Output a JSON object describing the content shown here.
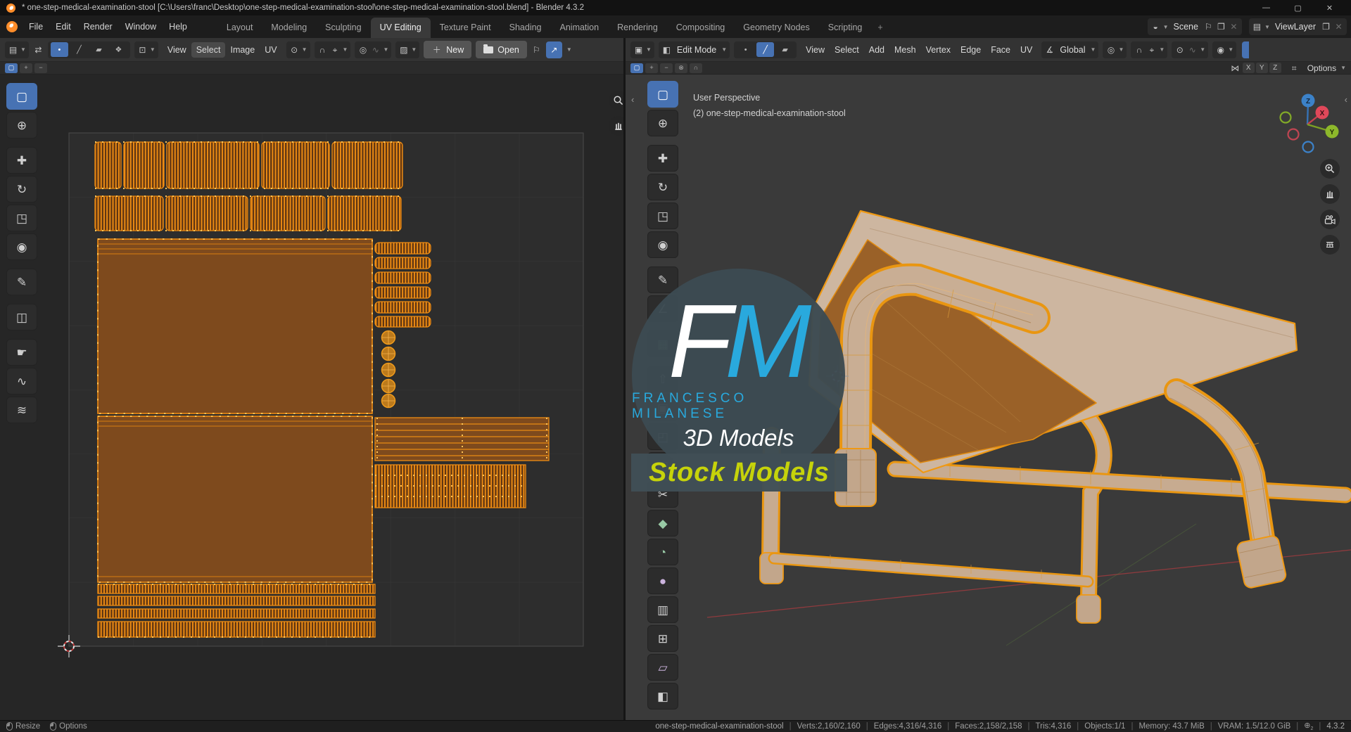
{
  "colors": {
    "blender_orange": "#e87d0d",
    "selection_blue": "#4772b3",
    "uv_edge_orange": "#ee8c13",
    "watermark_accent": "#29a9dd",
    "banner_text": "#c6d30a",
    "axis_x_red": "#e0485a",
    "axis_y_green": "#8db82b",
    "axis_z_blue": "#3c82c9"
  },
  "window": {
    "title": "* one-step-medical-examination-stool [C:\\Users\\franc\\Desktop\\one-step-medical-examination-stool\\one-step-medical-examination-stool.blend] - Blender 4.3.2",
    "minimize": "—",
    "maximize": "▢",
    "close": "✕"
  },
  "topbar": {
    "menus": [
      {
        "label": "File",
        "name": "menu-file"
      },
      {
        "label": "Edit",
        "name": "menu-edit"
      },
      {
        "label": "Render",
        "name": "menu-render"
      },
      {
        "label": "Window",
        "name": "menu-window"
      },
      {
        "label": "Help",
        "name": "menu-help"
      }
    ],
    "tabs": [
      {
        "label": "Layout",
        "name": "tab-layout"
      },
      {
        "label": "Modeling",
        "name": "tab-modeling"
      },
      {
        "label": "Sculpting",
        "name": "tab-sculpting"
      },
      {
        "label": "UV Editing",
        "name": "tab-uv-editing",
        "cls": "active"
      },
      {
        "label": "Texture Paint",
        "name": "tab-texture-paint"
      },
      {
        "label": "Shading",
        "name": "tab-shading"
      },
      {
        "label": "Animation",
        "name": "tab-animation"
      },
      {
        "label": "Rendering",
        "name": "tab-rendering"
      },
      {
        "label": "Compositing",
        "name": "tab-compositing"
      },
      {
        "label": "Geometry Nodes",
        "name": "tab-geometry-nodes"
      },
      {
        "label": "Scripting",
        "name": "tab-scripting"
      },
      {
        "label": "+",
        "name": "tab-add-workspace",
        "cls": "addtab"
      }
    ],
    "scene": {
      "label": "Scene"
    },
    "view_layer": {
      "label": "ViewLayer"
    }
  },
  "uv": {
    "menus": [
      {
        "label": "View",
        "name": "uv-menu-view"
      },
      {
        "label": "Select",
        "name": "uv-menu-select",
        "cls": "hovered"
      },
      {
        "label": "Image",
        "name": "uv-menu-image"
      },
      {
        "label": "UV",
        "name": "uv-menu-uv"
      }
    ],
    "select_modes": [
      {
        "glyph": "•",
        "name": "uv-select-mode-vertex",
        "cls": "active"
      },
      {
        "glyph": "╱",
        "name": "uv-select-mode-edge"
      },
      {
        "glyph": "▰",
        "name": "uv-select-mode-face"
      },
      {
        "glyph": "❖",
        "name": "uv-select-mode-island"
      }
    ],
    "toolrow_modes": [
      {
        "glyph": "▢",
        "name": "uv-tool-mode-set",
        "cls": "active"
      },
      {
        "glyph": "+",
        "name": "uv-tool-mode-extend"
      },
      {
        "glyph": "−",
        "name": "uv-tool-mode-subtract"
      }
    ],
    "new_label": "New",
    "open_label": "Open",
    "toolbar": [
      {
        "glyph": "▢",
        "name": "uv-tool-select-box",
        "cls": "active"
      },
      {
        "glyph": "⊕",
        "name": "uv-tool-2d-cursor"
      },
      {
        "glyph": "✚",
        "name": "uv-tool-move",
        "cls": "gap"
      },
      {
        "glyph": "↻",
        "name": "uv-tool-rotate"
      },
      {
        "glyph": "◳",
        "name": "uv-tool-scale"
      },
      {
        "glyph": "◉",
        "name": "uv-tool-transform"
      },
      {
        "glyph": "✎",
        "name": "uv-tool-annotate",
        "cls": "gap"
      },
      {
        "glyph": "◫",
        "name": "uv-tool-rip-region",
        "cls": "gap"
      },
      {
        "glyph": "☛",
        "name": "uv-tool-grab",
        "cls": "gap"
      },
      {
        "glyph": "∿",
        "name": "uv-tool-relax"
      },
      {
        "glyph": "≋",
        "name": "uv-tool-pinch"
      }
    ]
  },
  "vp": {
    "mode": "Edit Mode",
    "menus": [
      {
        "label": "View",
        "name": "vp-menu-view"
      },
      {
        "label": "Select",
        "name": "vp-menu-select"
      },
      {
        "label": "Add",
        "name": "vp-menu-add"
      },
      {
        "label": "Mesh",
        "name": "vp-menu-mesh"
      },
      {
        "label": "Vertex",
        "name": "vp-menu-vertex"
      },
      {
        "label": "Edge",
        "name": "vp-menu-edge"
      },
      {
        "label": "Face",
        "name": "vp-menu-face"
      },
      {
        "label": "UV",
        "name": "vp-menu-uv"
      }
    ],
    "select_modes": [
      {
        "glyph": "•",
        "name": "vp-select-mode-vertex"
      },
      {
        "glyph": "╱",
        "name": "vp-select-mode-edge",
        "cls": "active"
      },
      {
        "glyph": "▰",
        "name": "vp-select-mode-face"
      }
    ],
    "toolrow_modes": [
      {
        "glyph": "▢",
        "name": "vp-tool-mode-set",
        "cls": "active"
      },
      {
        "glyph": "+",
        "name": "vp-tool-mode-extend"
      },
      {
        "glyph": "−",
        "name": "vp-tool-mode-subtract"
      },
      {
        "glyph": "⊗",
        "name": "vp-tool-mode-invert"
      },
      {
        "glyph": "∩",
        "name": "vp-tool-mode-intersect"
      }
    ],
    "mirror_axes": [
      {
        "label": "X",
        "name": "mirror-x-toggle"
      },
      {
        "label": "Y",
        "name": "mirror-y-toggle"
      },
      {
        "label": "Z",
        "name": "mirror-z-toggle"
      }
    ],
    "orientation": "Global",
    "options_label": "Options",
    "overlay_perspective": "User Perspective",
    "overlay_object": "(2) one-step-medical-examination-stool",
    "gizmo": {
      "x": "X",
      "y": "Y",
      "z": "Z"
    },
    "toolbar": [
      {
        "glyph": "▢",
        "name": "vp-tool-select-box",
        "cls": "active"
      },
      {
        "glyph": "⊕",
        "name": "vp-tool-3d-cursor"
      },
      {
        "glyph": "✚",
        "name": "vp-tool-move",
        "cls": "gap"
      },
      {
        "glyph": "↻",
        "name": "vp-tool-rotate"
      },
      {
        "glyph": "◳",
        "name": "vp-tool-scale"
      },
      {
        "glyph": "◉",
        "name": "vp-tool-transform"
      },
      {
        "glyph": "✎",
        "name": "vp-tool-annotate",
        "cls": "gap"
      },
      {
        "glyph": "∠",
        "name": "vp-tool-measure"
      },
      {
        "glyph": "▦",
        "name": "vp-tool-add-cube",
        "cls": "gap",
        "color": "#98c9a5"
      },
      {
        "glyph": "⇧",
        "name": "vp-tool-extrude-region",
        "cls": "gap"
      },
      {
        "glyph": "▣",
        "name": "vp-tool-inset-faces"
      },
      {
        "glyph": "◰",
        "name": "vp-tool-bevel"
      },
      {
        "glyph": "◫",
        "name": "vp-tool-loop-cut"
      },
      {
        "glyph": "✂",
        "name": "vp-tool-knife"
      },
      {
        "glyph": "◆",
        "name": "vp-tool-poly-build",
        "color": "#98c9a5"
      },
      {
        "glyph": "◔",
        "name": "vp-tool-spin",
        "color": "#98c9a5"
      },
      {
        "glyph": "●",
        "name": "vp-tool-smooth",
        "color": "#cbb3dd"
      },
      {
        "glyph": "▥",
        "name": "vp-tool-edge-slide"
      },
      {
        "glyph": "⊞",
        "name": "vp-tool-shrink-fatten"
      },
      {
        "glyph": "▱",
        "name": "vp-tool-shear",
        "color": "#cbb3dd"
      },
      {
        "glyph": "◧",
        "name": "vp-tool-rip-region"
      }
    ]
  },
  "watermark": {
    "f": "F",
    "m": "M",
    "line1": "FRANCESCO MILANESE",
    "line2": "3D Models",
    "banner": "Stock Models"
  },
  "status": {
    "hints": [
      {
        "label": "Resize",
        "name": "status-hint-resize"
      },
      {
        "label": "Options",
        "name": "status-hint-options"
      }
    ],
    "object": "one-step-medical-examination-stool",
    "stats": [
      "Verts:2,160/2,160",
      "Edges:4,316/4,316",
      "Faces:2,158/2,158",
      "Tris:4,316",
      "Objects:1/1",
      "Memory: 43.7 MiB",
      "VRAM: 1.5/12.0 GiB"
    ],
    "version": "4.3.2"
  }
}
